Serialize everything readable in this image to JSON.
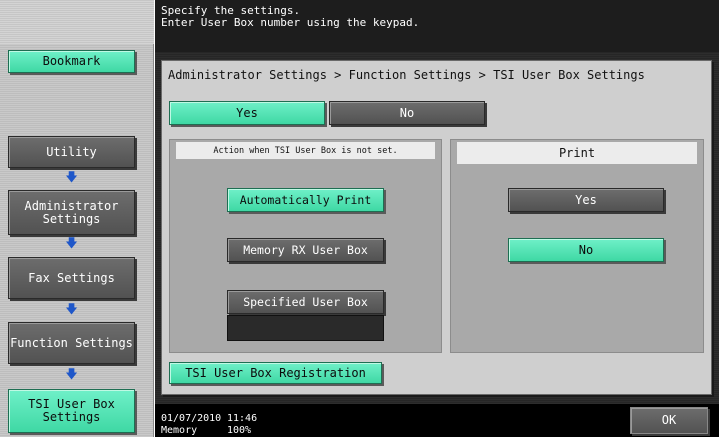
{
  "header": {
    "line1": "Specify the settings.",
    "line2": "Enter User Box number using the keypad."
  },
  "sidebar": {
    "bookmark_label": "Bookmark",
    "items": [
      {
        "label": "Utility",
        "state": "inactive"
      },
      {
        "label": "Administrator Settings",
        "state": "inactive"
      },
      {
        "label": "Fax Settings",
        "state": "inactive"
      },
      {
        "label": "Function Settings",
        "state": "inactive"
      },
      {
        "label": "TSI User Box Settings",
        "state": "active"
      }
    ],
    "arrow_icon": "down-arrow-icon"
  },
  "breadcrumb": "Administrator Settings > Function Settings > TSI User Box Settings",
  "toggle": {
    "yes_label": "Yes",
    "no_label": "No",
    "selected": "Yes"
  },
  "action_panel": {
    "heading": "Action when TSI User Box is not set.",
    "options": [
      {
        "label": "Automatically Print",
        "selected": true
      },
      {
        "label": "Memory RX User Box",
        "selected": false
      },
      {
        "label": "Specified User Box",
        "selected": false
      }
    ],
    "specified_box_value": ""
  },
  "print_panel": {
    "heading": "Print",
    "options": [
      {
        "label": "Yes",
        "selected": false
      },
      {
        "label": "No",
        "selected": true
      }
    ]
  },
  "registration_button": "TSI User Box Registration",
  "footer": {
    "date": "01/07/2010",
    "time": "11:46",
    "memory_label": "Memory",
    "memory_value": "100%"
  },
  "ok_label": "OK",
  "colors": {
    "selected_green": "#3fd8a4",
    "unselected_gray": "#5c5c5c",
    "arrow_blue": "#1f57c9",
    "header_black": "#1d1d1d"
  }
}
